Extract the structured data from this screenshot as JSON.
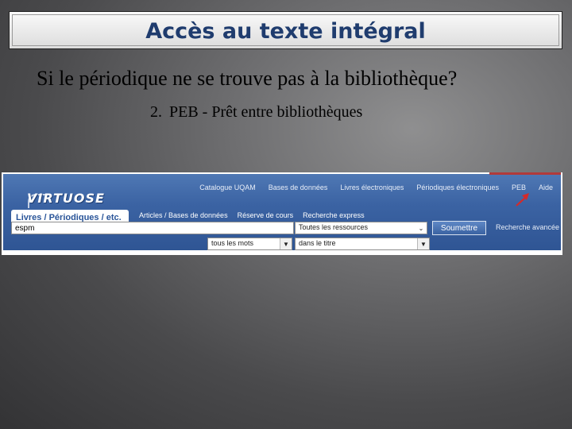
{
  "slide": {
    "title": "Accès au texte intégral",
    "question": "Si le périodique ne se trouve pas à la bibliothèque?",
    "item_number": "2.",
    "item_text": "PEB - Prêt entre bibliothèques"
  },
  "app": {
    "logo": "VIRTUOSE",
    "top_links": [
      "Catalogue UQAM",
      "Bases de données",
      "Livres électroniques",
      "Périodiques électroniques",
      "PEB",
      "Aide"
    ],
    "active_tab": "Livres / Périodiques / etc.",
    "tabs": [
      "Articles / Bases de données",
      "Réserve de cours",
      "Recherche express"
    ],
    "search_value": "espm",
    "resource_select": "Toutes les ressources",
    "words_select": "tous les mots",
    "field_select": "dans le titre",
    "submit_label": "Soumettre",
    "advanced_link": "Recherche avancée"
  },
  "colors": {
    "title_text": "#1f3c6e",
    "banner": "#3b63a3",
    "arrow": "#d42a2a"
  }
}
